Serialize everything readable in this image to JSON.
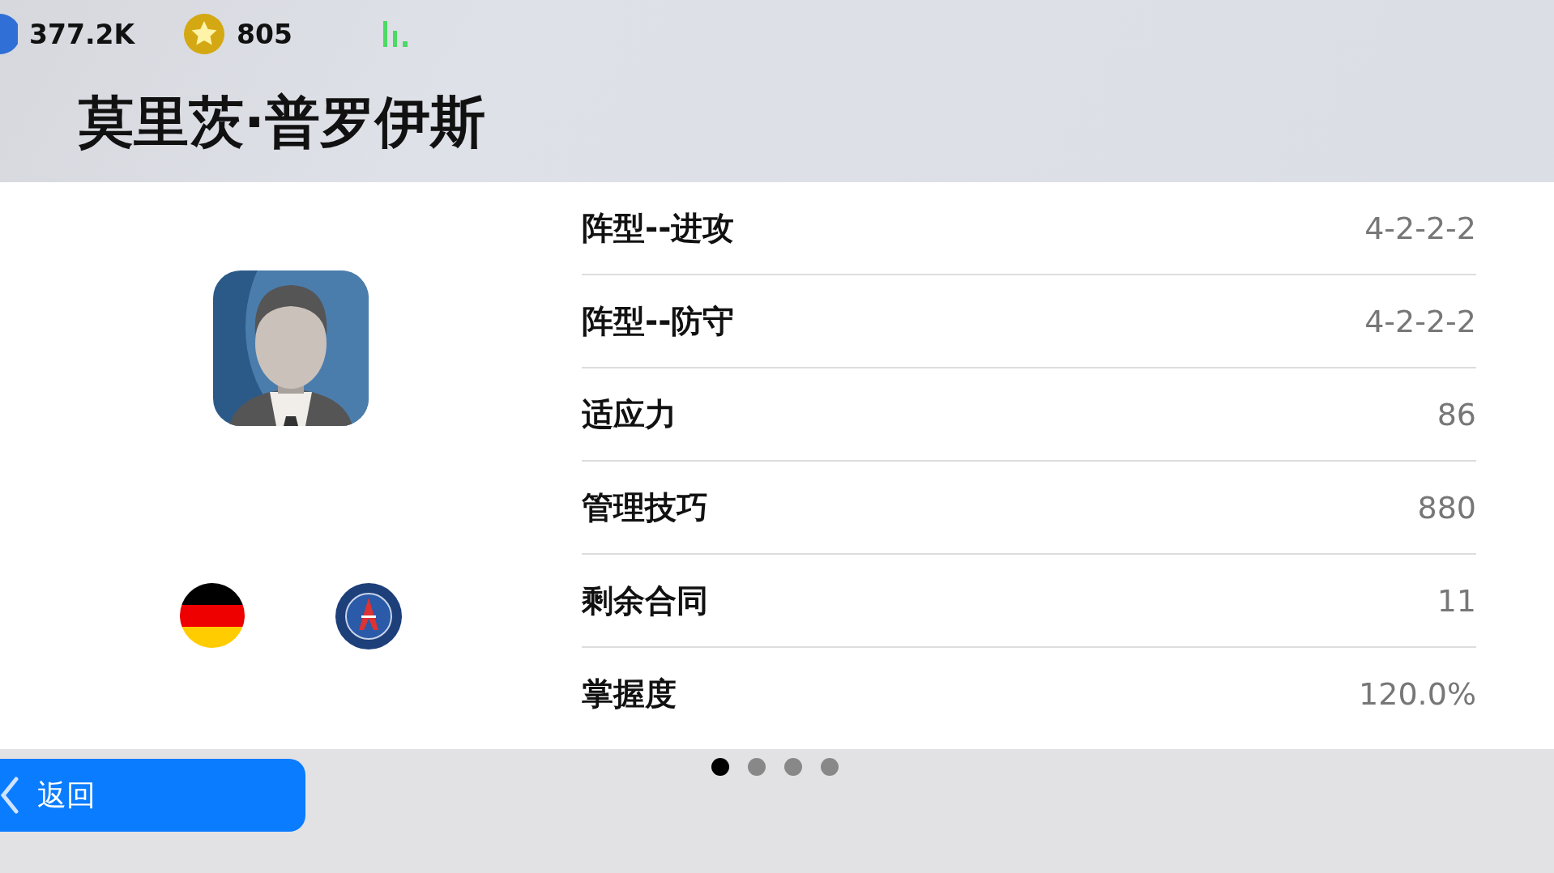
{
  "currency_bar": [
    {
      "kind": "gp",
      "amount": "377.2K"
    },
    {
      "kind": "coin",
      "amount": "805"
    }
  ],
  "manager_name": "莫里茨·普罗伊斯",
  "stats": [
    {
      "label": "阵型--进攻",
      "value": "4-2-2-2"
    },
    {
      "label": "阵型--防守",
      "value": "4-2-2-2"
    },
    {
      "label": "适应力",
      "value": "86"
    },
    {
      "label": "管理技巧",
      "value": "880"
    },
    {
      "label": "剩余合同",
      "value": "11"
    },
    {
      "label": "掌握度",
      "value": "120.0%"
    }
  ],
  "pages": [
    {
      "selected": true
    },
    {
      "selected": false
    },
    {
      "selected": false
    },
    {
      "selected": false
    }
  ],
  "back_button": {
    "label": "返回"
  }
}
